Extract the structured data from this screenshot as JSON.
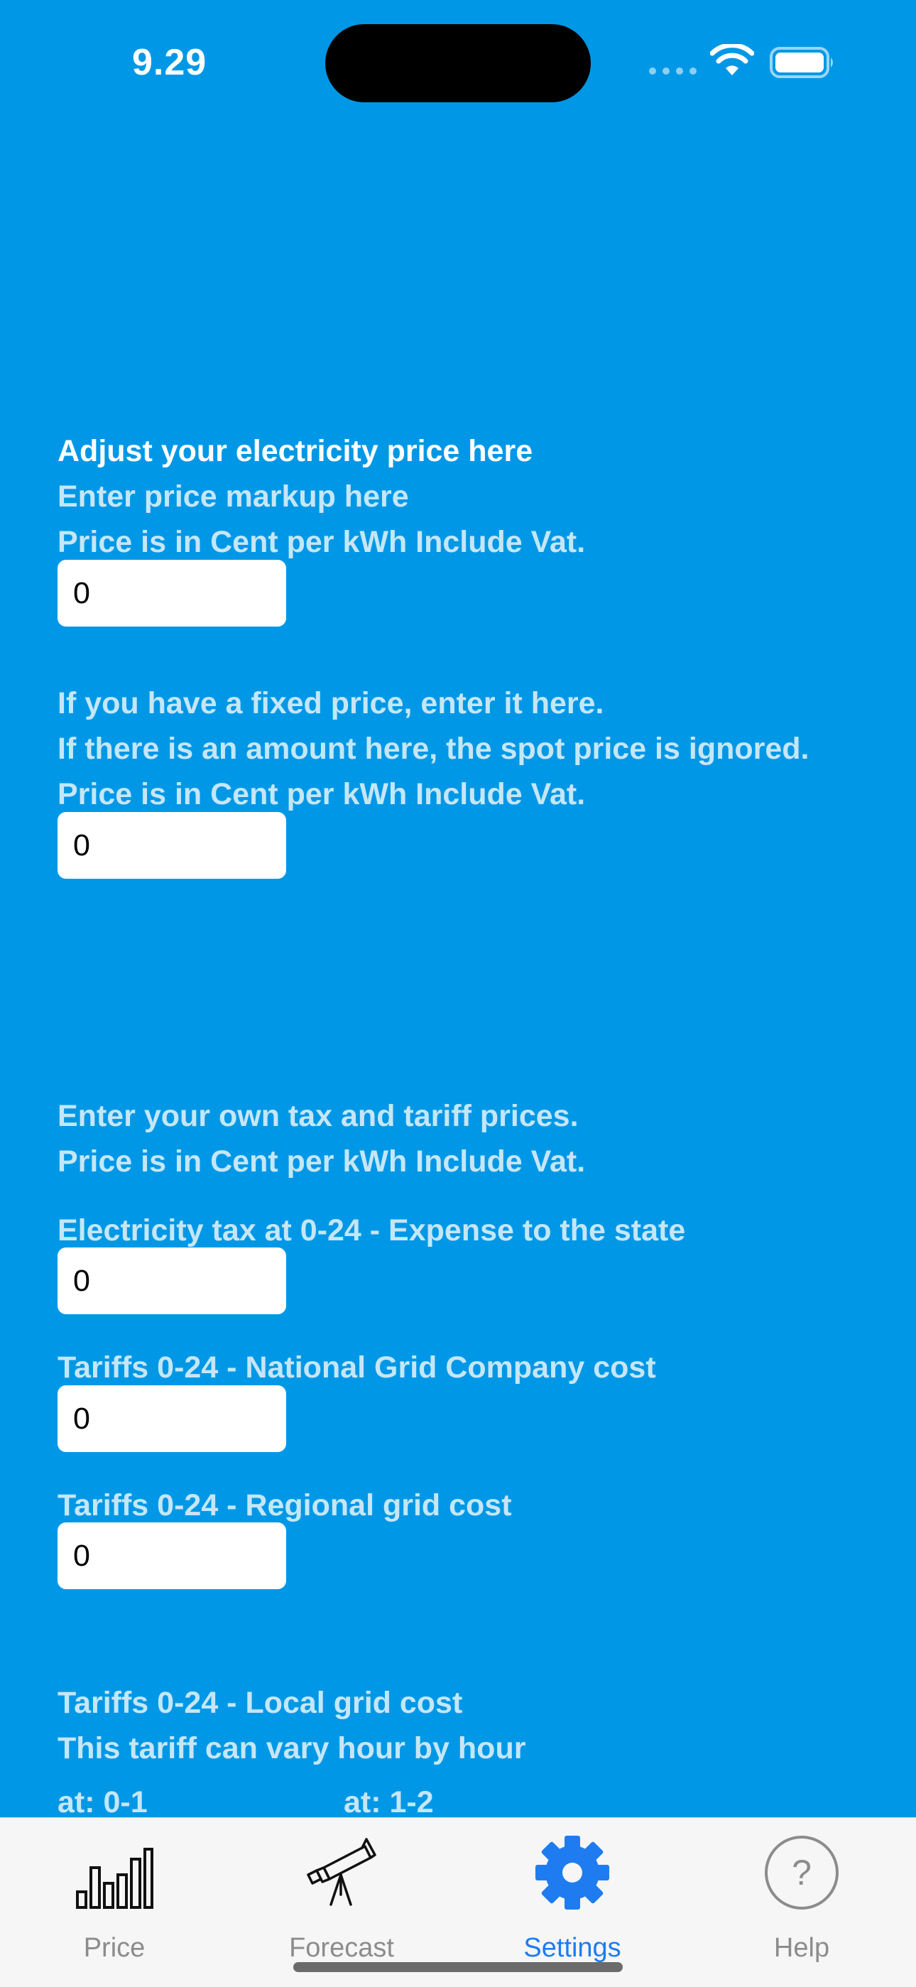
{
  "status_bar": {
    "time": "9.29"
  },
  "settings": {
    "markup": {
      "heading": "Adjust your electricity price here",
      "line1": "Enter price markup here",
      "line2": "Price is in Cent per kWh Include Vat.",
      "value": "0"
    },
    "fixed": {
      "line1": "If you have a fixed price, enter it here.",
      "line2": "If there is an amount here, the spot price is ignored.",
      "line3": "Price is in Cent per kWh Include Vat.",
      "value": "0"
    },
    "tax": {
      "line1": "Enter your own tax and tariff prices.",
      "line2": "Price is in Cent per kWh Include Vat."
    },
    "electricity_tax": {
      "label": "Electricity tax at 0-24 - Expense to the state",
      "value": "0"
    },
    "national_grid": {
      "label": "Tariffs 0-24 - National Grid Company cost",
      "value": "0"
    },
    "regional_grid": {
      "label": "Tariffs 0-24 - Regional grid cost",
      "value": "0"
    },
    "local_grid": {
      "label": "Tariffs 0-24 - Local grid cost",
      "note": "This tariff can vary hour by hour",
      "hour_labels": [
        "at: 0-1",
        "at: 1-2"
      ]
    }
  },
  "tab_bar": {
    "tabs": [
      {
        "label": "Price",
        "icon": "bar-chart-icon",
        "active": false
      },
      {
        "label": "Forecast",
        "icon": "telescope-icon",
        "active": false
      },
      {
        "label": "Settings",
        "icon": "gear-icon",
        "active": true
      },
      {
        "label": "Help",
        "icon": "question-icon",
        "active": false
      }
    ]
  },
  "colors": {
    "background": "#0098E6",
    "text_primary": "#FFFFFF",
    "text_secondary": "#C5E6F7",
    "tab_active": "#1E7CF0",
    "tab_inactive": "#8C8C8C"
  }
}
